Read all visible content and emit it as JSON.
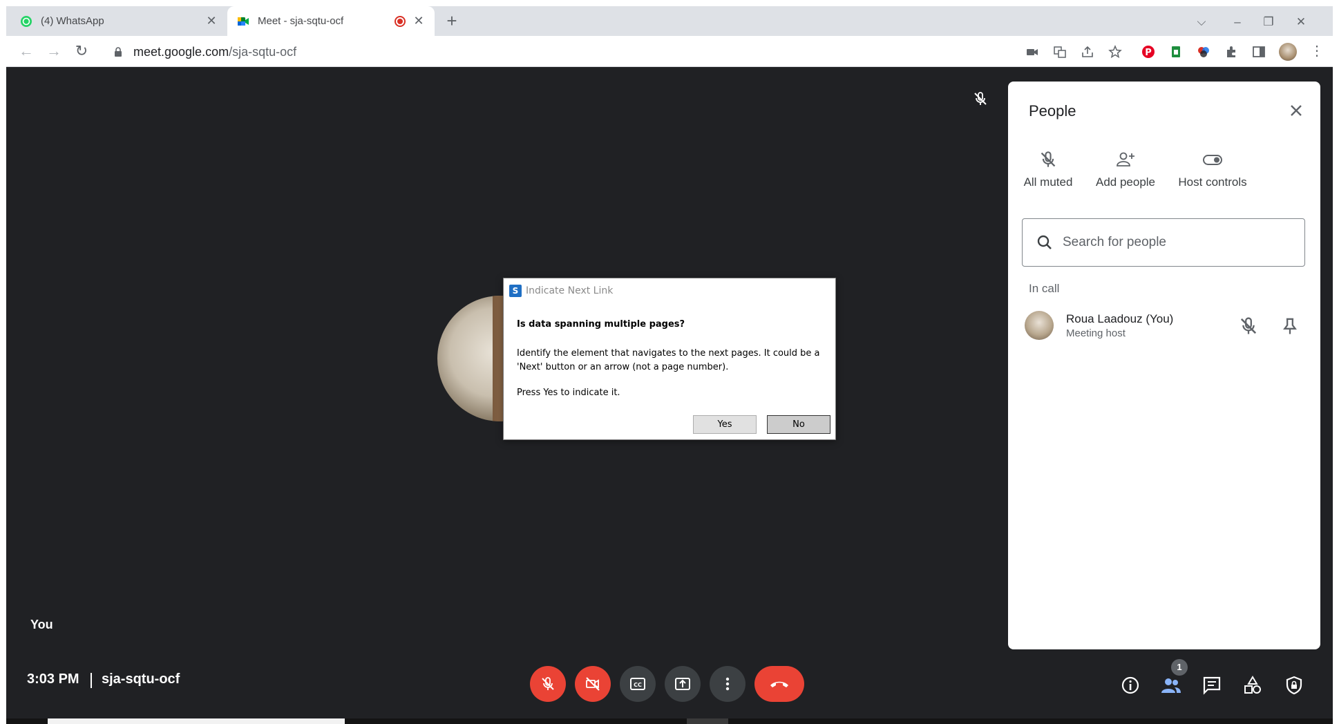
{
  "browser": {
    "tabs": [
      {
        "title": "(4) WhatsApp",
        "active": false
      },
      {
        "title": "Meet - sja-sqtu-ocf",
        "active": true,
        "recording": true
      }
    ],
    "address": {
      "host": "meet.google.com",
      "path": "/sja-sqtu-ocf"
    }
  },
  "meet": {
    "tile_label": "You",
    "time": "3:03 PM",
    "meeting_code": "sja-sqtu-ocf",
    "participants_badge": "1"
  },
  "people_panel": {
    "title": "People",
    "actions": [
      {
        "label": "All muted",
        "icon": "mic-off-icon"
      },
      {
        "label": "Add people",
        "icon": "add-person-icon"
      },
      {
        "label": "Host controls",
        "icon": "toggle-icon"
      }
    ],
    "search_placeholder": "Search for people",
    "section_label": "In call",
    "participant": {
      "name": "Roua Laadouz (You)",
      "role": "Meeting host"
    }
  },
  "dialog": {
    "title": "Indicate Next Link",
    "question": "Is data spanning multiple pages?",
    "body": "Identify the element that navigates to the next pages. It could be a 'Next' button or an arrow (not a page number).",
    "instruction": "Press Yes to indicate it.",
    "yes_label": "Yes",
    "no_label": "No"
  },
  "colors": {
    "meet_background": "#202124",
    "danger_red": "#ea4335",
    "control_gray": "#3c4043",
    "active_blue": "#8ab4f8"
  }
}
